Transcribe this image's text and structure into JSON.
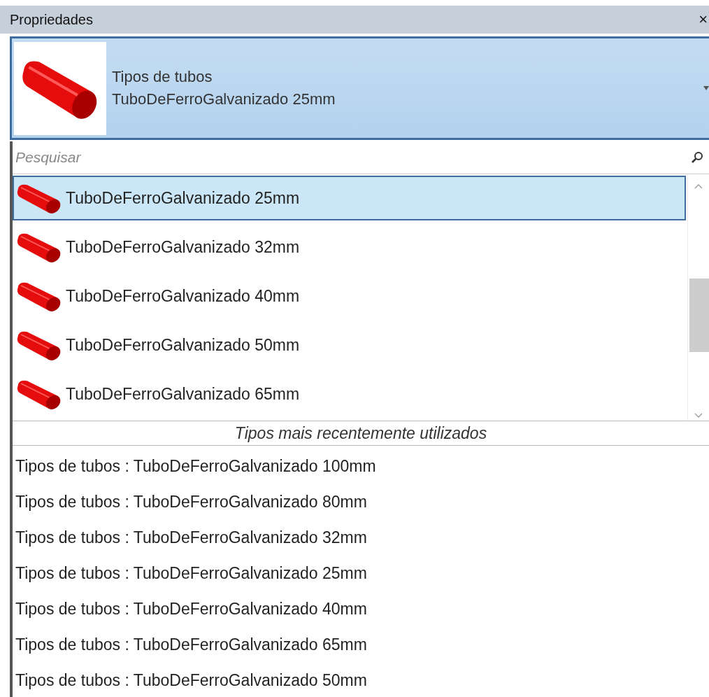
{
  "panel": {
    "title": "Propriedades",
    "close": "×"
  },
  "type_selector": {
    "category": "Tipos de tubos",
    "type": "TuboDeFerroGalvanizado 25mm"
  },
  "search": {
    "placeholder": "Pesquisar"
  },
  "types": [
    {
      "label": "TuboDeFerroGalvanizado 25mm",
      "selected": true
    },
    {
      "label": "TuboDeFerroGalvanizado 32mm",
      "selected": false
    },
    {
      "label": "TuboDeFerroGalvanizado 40mm",
      "selected": false
    },
    {
      "label": "TuboDeFerroGalvanizado 50mm",
      "selected": false
    },
    {
      "label": "TuboDeFerroGalvanizado 65mm",
      "selected": false
    }
  ],
  "recent": {
    "heading": "Tipos mais recentemente utilizados",
    "items": [
      "Tipos de tubos : TuboDeFerroGalvanizado 100mm",
      "Tipos de tubos : TuboDeFerroGalvanizado 80mm",
      "Tipos de tubos : TuboDeFerroGalvanizado 32mm",
      "Tipos de tubos : TuboDeFerroGalvanizado 25mm",
      "Tipos de tubos : TuboDeFerroGalvanizado 40mm",
      "Tipos de tubos : TuboDeFerroGalvanizado 65mm",
      "Tipos de tubos : TuboDeFerroGalvanizado 50mm"
    ]
  }
}
